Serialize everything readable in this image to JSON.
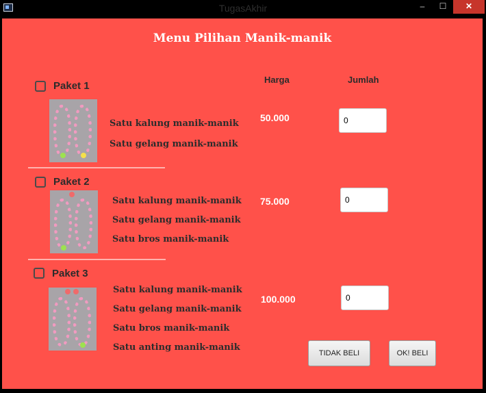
{
  "window": {
    "title": "TugasAkhir",
    "minimize": "–",
    "maximize": "☐",
    "close": "✕"
  },
  "heading": "Menu Pilihan Manik-manik",
  "columns": {
    "harga": "Harga",
    "jumlah": "Jumlah"
  },
  "packages": [
    {
      "label": "Paket 1",
      "items": [
        "Satu kalung manik-manik",
        "Satu gelang manik-manik"
      ],
      "price": "50.000",
      "quantity": "0"
    },
    {
      "label": "Paket 2",
      "items": [
        "Satu kalung manik-manik",
        "Satu gelang manik-manik",
        "Satu bros manik-manik"
      ],
      "price": "75.000",
      "quantity": "0"
    },
    {
      "label": "Paket 3",
      "items": [
        "Satu kalung manik-manik",
        "Satu gelang manik-manik",
        "Satu bros manik-manik",
        "Satu anting manik-manik"
      ],
      "price": "100.000",
      "quantity": "0"
    }
  ],
  "buttons": {
    "cancel": "TIDAK BELI",
    "ok": "OK! BELI"
  },
  "colors": {
    "background": "#ff514a",
    "title_bar": "#000000",
    "close_button": "#c7352b"
  }
}
